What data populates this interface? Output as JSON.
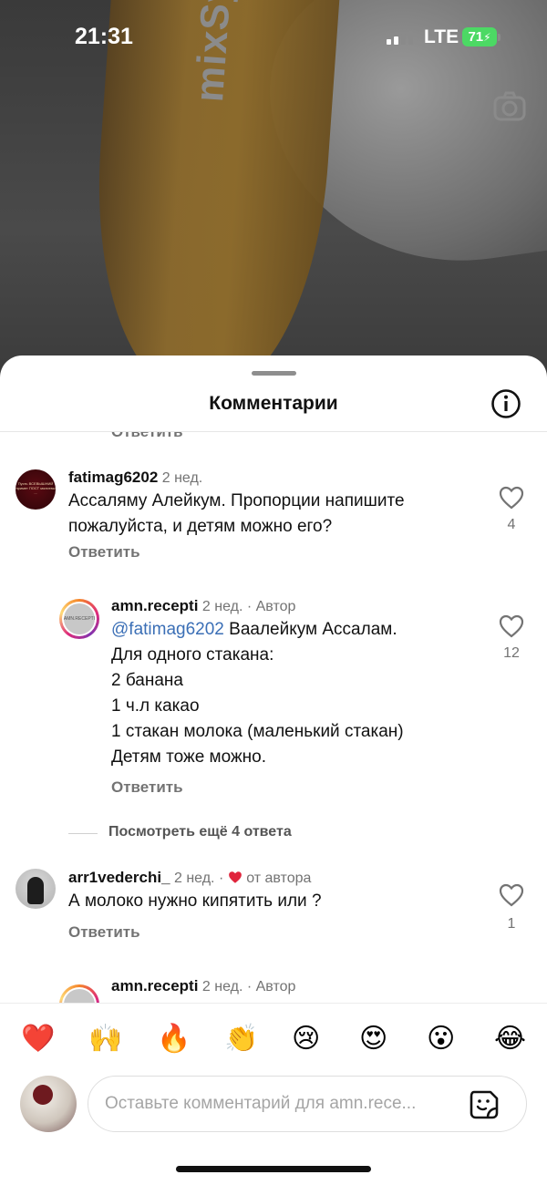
{
  "status": {
    "time": "21:31",
    "network": "LTE",
    "battery": "71"
  },
  "video": {
    "product_text": "mixSy"
  },
  "sheet": {
    "title": "Комментарии"
  },
  "colors": {
    "mention": "#3b6fb6",
    "like_heart": "#e0243c",
    "battery": "#4cd964"
  },
  "comments": {
    "cut_reply_label": "Ответить",
    "c1": {
      "username": "fatimag6202",
      "time": "2 нед.",
      "text_line1": "Ассаляму Алейкум. Пропорции напишите",
      "text_line2": "пожалуйста, и детям можно его?",
      "likes": "4",
      "reply_label": "Ответить",
      "avatar_text": "Пусть ВСЕВЫШНИЙ примет ПОСТ молитвы ..."
    },
    "r1": {
      "username": "amn.recepti",
      "time": "2 нед.",
      "author_tag": "· Автор",
      "mention": "@fatimag6202",
      "text_line1_rest": " Ваалейкум Ассалам.",
      "text_line2": "Для одного стакана:",
      "text_line3": "2 банана",
      "text_line4": "1 ч.л какао",
      "text_line5": "1 стакан молока (маленький стакан)",
      "text_line6": "Детям тоже можно.",
      "likes": "12",
      "reply_label": "Ответить",
      "avatar_text": "AMN.RECEPTI"
    },
    "view_more": "Посмотреть ещё 4 ответа",
    "c2": {
      "username": "arr1vederchi_",
      "time": "2 нед.",
      "liked_by_author": "от автора",
      "text": "А молоко нужно кипятить или ?",
      "likes": "1",
      "reply_label": "Ответить"
    },
    "r2": {
      "username": "amn.recepti",
      "time": "2 нед.",
      "author_tag": "· Автор"
    }
  },
  "reactions": [
    "❤️",
    "🙌",
    "🔥",
    "👏",
    "😢",
    "😍",
    "😮",
    "😂"
  ],
  "composer": {
    "placeholder": "Оставьте комментарий для amn.rece..."
  }
}
